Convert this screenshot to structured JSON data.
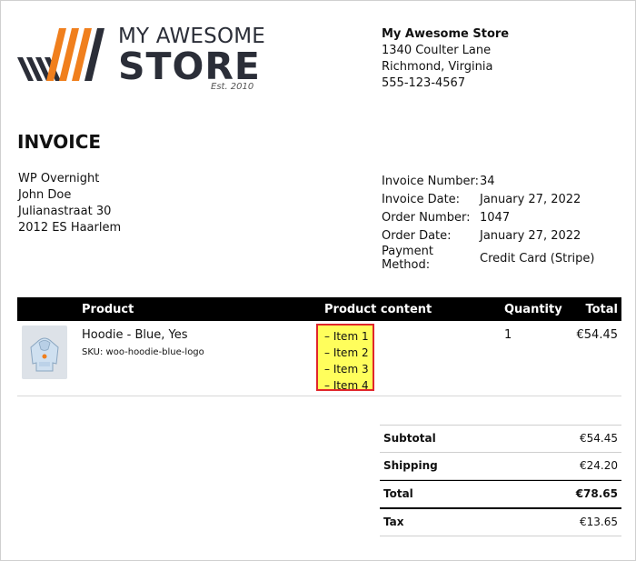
{
  "logo": {
    "line1": "MY AWESOME",
    "line2": "STORE",
    "established": "Est. 2010",
    "stripe_colors": [
      "#2b2e38",
      "#f07f1d"
    ]
  },
  "store": {
    "name": "My Awesome Store",
    "address_line1": "1340 Coulter Lane",
    "address_line2": "Richmond, Virginia",
    "phone": "555-123-4567"
  },
  "document_title": "INVOICE",
  "billing": {
    "company": "WP Overnight",
    "name": "John Doe",
    "street": "Julianastraat 30",
    "postcode_city": "2012 ES Haarlem"
  },
  "invoice_meta": [
    {
      "label": "Invoice Number:",
      "value": "34"
    },
    {
      "label": "Invoice Date:",
      "value": "January 27, 2022"
    },
    {
      "label": "Order Number:",
      "value": "1047"
    },
    {
      "label": "Order Date:",
      "value": "January 27, 2022"
    },
    {
      "label": "Payment Method:",
      "value": "Credit Card (Stripe)"
    }
  ],
  "items_table": {
    "headers": {
      "product": "Product",
      "content": "Product content",
      "quantity": "Quantity",
      "total": "Total"
    },
    "rows": [
      {
        "image_icon": "hoodie-thumbnail",
        "name": "Hoodie - Blue, Yes",
        "sku_label": "SKU:",
        "sku": "woo-hoodie-blue-logo",
        "content_items": [
          "– Item 1",
          "– Item 2",
          "– Item 3",
          "– Item 4"
        ],
        "quantity": "1",
        "total": "€54.45"
      }
    ],
    "highlight_fill": "#fffe5c",
    "highlight_border": "#e0262c"
  },
  "totals": [
    {
      "label": "Subtotal",
      "value": "€54.45"
    },
    {
      "label": "Shipping",
      "value": "€24.20"
    },
    {
      "label": "Total",
      "value": "€78.65"
    },
    {
      "label": "Tax",
      "value": "€13.65"
    }
  ]
}
